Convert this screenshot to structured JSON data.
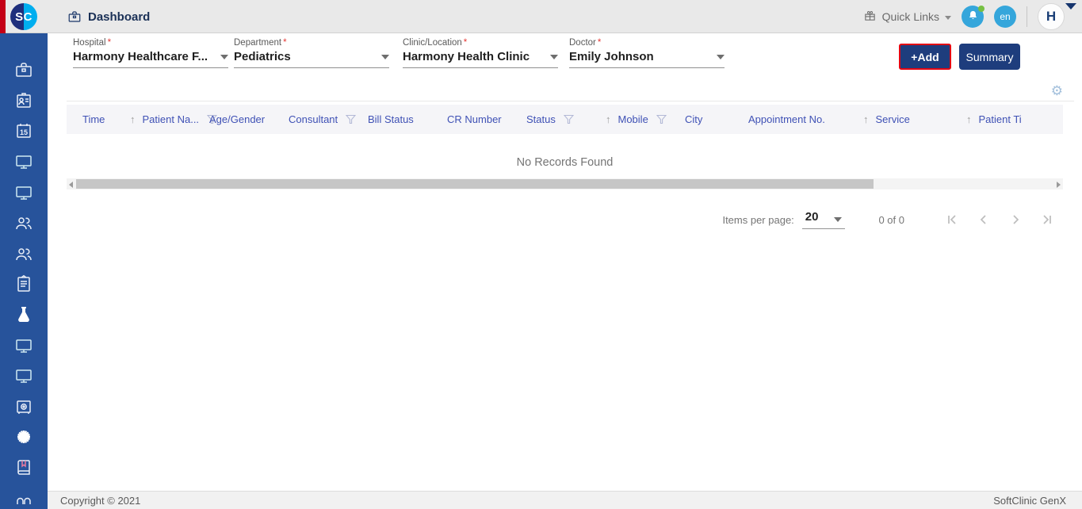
{
  "colors": {
    "sidebar_blue": "#27539b",
    "primary_navy": "#1e3d7d",
    "logo_cyan": "#00aeef",
    "logo_navy": "#1f2f7c",
    "accent_blue": "#35a6db",
    "highlight_red": "#e30613",
    "table_header_text": "#3f51b5",
    "notification_green": "#76c043"
  },
  "header": {
    "logo_text": "SC",
    "title": "Dashboard",
    "quick_links_label": "Quick Links",
    "language_badge": "en",
    "avatar_letter": "H"
  },
  "sidebar": {
    "icons": [
      "briefcase",
      "id-card",
      "calendar-15",
      "monitor",
      "monitor",
      "users",
      "users",
      "clipboard",
      "flask",
      "monitor",
      "monitor",
      "safe",
      "starburst",
      "book",
      "glasses"
    ]
  },
  "filters": {
    "required_mark": "*",
    "fields": [
      {
        "label": "Hospital",
        "value": "Harmony Healthcare F..."
      },
      {
        "label": "Department",
        "value": "Pediatrics"
      },
      {
        "label": "Clinic/Location",
        "value": "Harmony Health Clinic"
      },
      {
        "label": "Doctor",
        "value": "Emily Johnson"
      }
    ],
    "add_button": "+Add",
    "summary_button": "Summary"
  },
  "table": {
    "columns": [
      {
        "label": "Time"
      },
      {
        "label": "Patient Na...",
        "sort": true,
        "filter": true
      },
      {
        "label": "Age/Gender"
      },
      {
        "label": "Consultant",
        "filter": true
      },
      {
        "label": "Bill Status"
      },
      {
        "label": "CR Number"
      },
      {
        "label": "Status",
        "filter": true
      },
      {
        "label": "Mobile",
        "sort": true,
        "filter": true
      },
      {
        "label": "City"
      },
      {
        "label": "Appointment No."
      },
      {
        "label": "Service",
        "sort": true
      },
      {
        "label": "Patient Ti",
        "sort": true
      }
    ],
    "empty_message": "No Records Found"
  },
  "pagination": {
    "items_per_page_label": "Items per page:",
    "items_per_page_value": "20",
    "range_label": "0 of 0"
  },
  "footer": {
    "copyright": "Copyright © 2021",
    "brand": "SoftClinic GenX"
  }
}
